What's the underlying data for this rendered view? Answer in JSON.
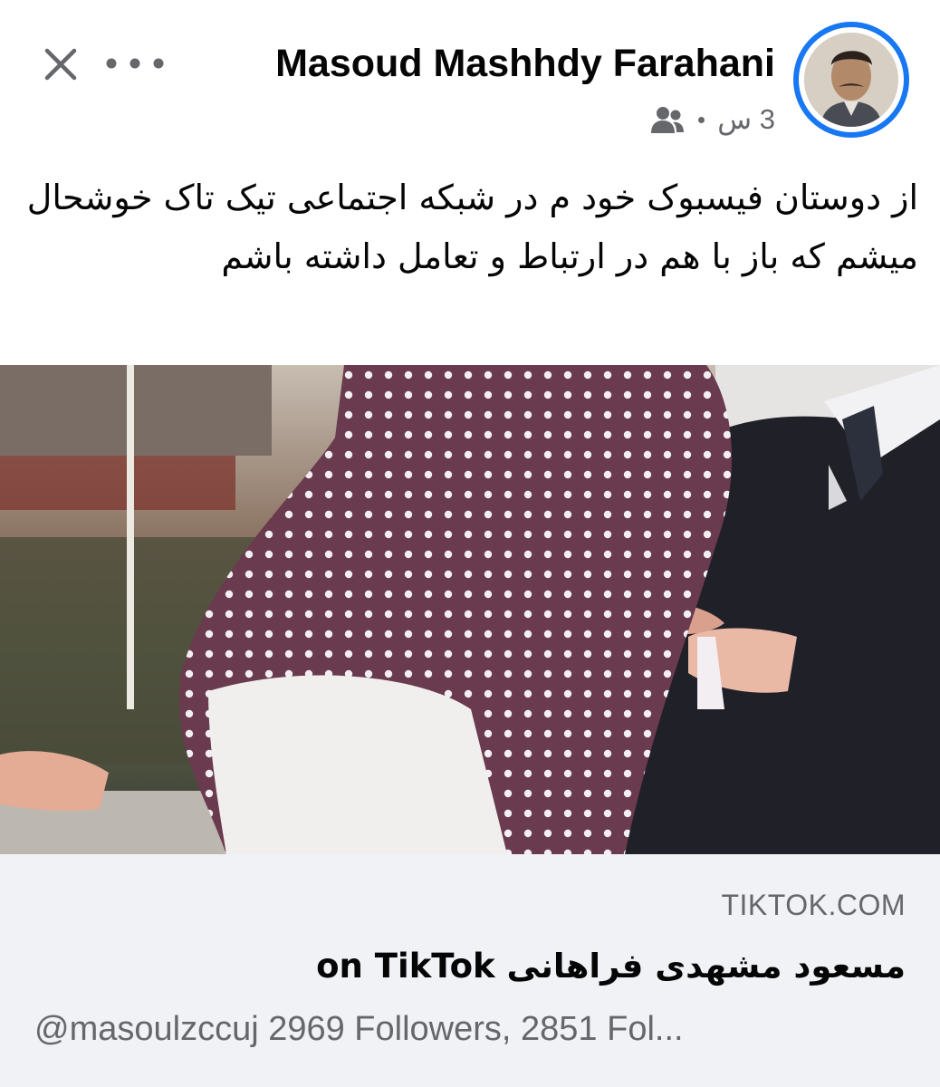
{
  "header": {
    "author_name": "Masoud Mashhdy Farahani",
    "timestamp": "3 س",
    "audience_icon": "friends-icon",
    "close_icon": "close-icon",
    "more_icon": "more-options-icon"
  },
  "post": {
    "text": "از دوستان فیسبوک خود م در شبکه اجتماعی تیک تاک خوشحال میشم که باز با هم در ارتباط و تعامل داشته باشم"
  },
  "link_preview": {
    "domain": "TIKTOK.COM",
    "title": "مسعود مشهدی فراهانی on TikTok",
    "description": "@masoulzccuj 2969 Followers, 2851 Fol..."
  },
  "colors": {
    "accent": "#1877f2",
    "secondary_text": "#65676b",
    "link_bg": "#f0f2f5"
  }
}
